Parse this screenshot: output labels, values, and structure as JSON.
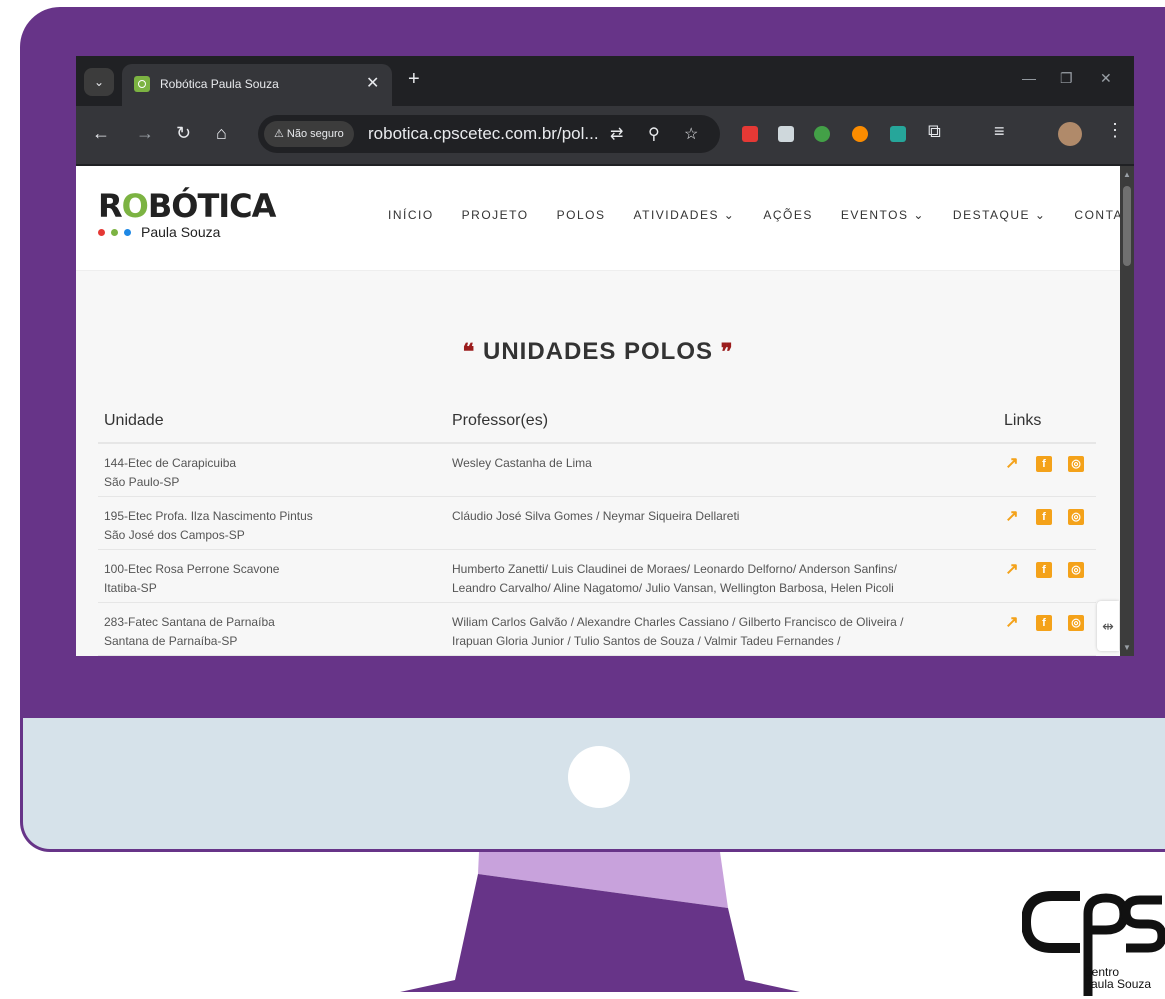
{
  "browser": {
    "tab_title": "Robótica Paula Souza",
    "security_label": "Não seguro",
    "url": "robotica.cpscetec.com.br/pol..."
  },
  "site": {
    "logo_word_start": "R",
    "logo_word_o": "O",
    "logo_word_end": "BÓTICA",
    "logo_sub": "Paula Souza",
    "nav": [
      "INÍCIO",
      "PROJETO",
      "POLOS",
      "ATIVIDADES ⌄",
      "AÇÕES",
      "EVENTOS ⌄",
      "DESTAQUE ⌄",
      "CONTATO"
    ],
    "section_title": "UNIDADES POLOS",
    "table": {
      "headers": {
        "unit": "Unidade",
        "prof": "Professor(es)",
        "links": "Links"
      },
      "rows": [
        {
          "unit": "144-Etec de Carapicuiba",
          "city": "São Paulo-SP",
          "prof1": "Wesley Castanha de Lima",
          "prof2": ""
        },
        {
          "unit": "195-Etec Profa. Ilza Nascimento Pintus",
          "city": "São José dos Campos-SP",
          "prof1": "Cláudio José Silva Gomes / Neymar Siqueira Dellareti",
          "prof2": ""
        },
        {
          "unit": "100-Etec Rosa Perrone Scavone",
          "city": "Itatiba-SP",
          "prof1": "Humberto Zanetti/ Luis Claudinei de Moraes/ Leonardo Delforno/ Anderson Sanfins/",
          "prof2": "Leandro Carvalho/ Aline Nagatomo/ Julio Vansan, Wellington Barbosa, Helen Picoli"
        },
        {
          "unit": "283-Fatec Santana de Parnaíba",
          "city": "Santana de Parnaíba-SP",
          "prof1": "Wiliam Carlos Galvão / Alexandre Charles Cassiano / Gilberto Francisco de Oliveira /",
          "prof2": "Irapuan Gloria Junior / Tulio Santos de Souza / Valmir Tadeu Fernandes /"
        }
      ]
    }
  },
  "brand": {
    "logo_mark": "cps",
    "logo_line1": "Centro",
    "logo_line2": "Paula Souza"
  },
  "colors": {
    "monitor": "#673488",
    "monitor_light": "#c8a2dc",
    "chin": "#d6e2ea",
    "accent_orange": "#f4a21a",
    "quote_red": "#9b1c1c",
    "logo_green": "#7cb342"
  },
  "icons": [
    "chevron-down-icon",
    "close-icon",
    "plus-icon",
    "back-icon",
    "forward-icon",
    "reload-icon",
    "home-icon",
    "warning-icon",
    "translate-icon",
    "zoom-icon",
    "star-icon",
    "puzzle-icon",
    "menu-dots-icon",
    "external-link-icon",
    "facebook-icon",
    "instagram-icon"
  ]
}
